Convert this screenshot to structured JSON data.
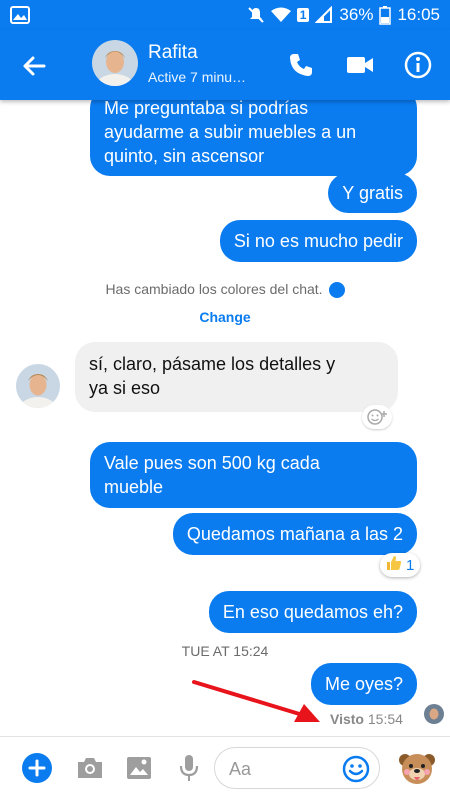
{
  "status_bar": {
    "sim_badge": "1",
    "battery": "36%",
    "time": "16:05"
  },
  "header": {
    "name": "Rafita",
    "status": "Active 7 minu…"
  },
  "messages": {
    "m1_line1": "Me preguntaba si podrías",
    "m1_line2": "ayudarme a subir muebles a un",
    "m1_line3": "quinto, sin ascensor",
    "m2": "Y gratis",
    "m3": "Si no es mucho pedir",
    "system_note": "Has cambiado los colores del chat.",
    "change_link": "Change",
    "m4_line1": "sí, claro, pásame los detalles y",
    "m4_line2": "ya si eso",
    "m5_line1": "Vale pues son 500 kg cada",
    "m5_line2": "mueble",
    "m6": "Quedamos mañana a las 2",
    "m6_reaction_count": "1",
    "m7": "En eso quedamos eh?",
    "timestamp": "TUE AT 15:24",
    "m8": "Me oyes?",
    "seen_label": "Visto",
    "seen_time": "15:54"
  },
  "composer": {
    "placeholder": "Aa"
  },
  "colors": {
    "accent": "#0a7cf0",
    "incoming_bubble": "#f1f0f0",
    "arrow": "#e8141b"
  },
  "icons": [
    "image-icon",
    "mute-icon",
    "wifi-icon",
    "signal-icon",
    "battery-icon",
    "back-arrow-icon",
    "phone-icon",
    "video-camera-icon",
    "info-icon",
    "add-emoji-icon",
    "thumbs-up-icon",
    "plus-icon",
    "camera-icon",
    "gallery-icon",
    "microphone-icon",
    "smiley-icon",
    "sticker-icon"
  ]
}
